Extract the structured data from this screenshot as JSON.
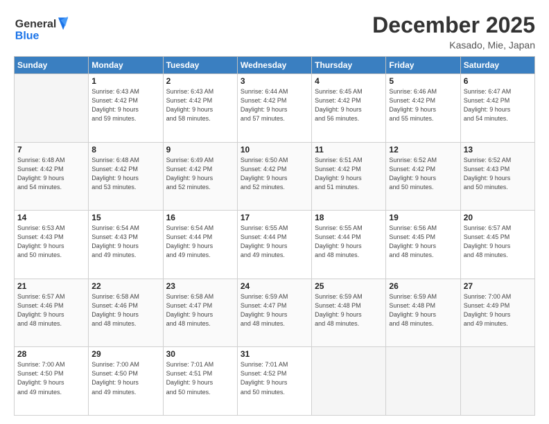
{
  "header": {
    "logo_general": "General",
    "logo_blue": "Blue",
    "month_title": "December 2025",
    "location": "Kasado, Mie, Japan"
  },
  "days_of_week": [
    "Sunday",
    "Monday",
    "Tuesday",
    "Wednesday",
    "Thursday",
    "Friday",
    "Saturday"
  ],
  "weeks": [
    [
      {
        "day": "",
        "empty": true
      },
      {
        "day": "1",
        "sunrise": "Sunrise: 6:43 AM",
        "sunset": "Sunset: 4:42 PM",
        "daylight": "Daylight: 9 hours and 59 minutes."
      },
      {
        "day": "2",
        "sunrise": "Sunrise: 6:43 AM",
        "sunset": "Sunset: 4:42 PM",
        "daylight": "Daylight: 9 hours and 58 minutes."
      },
      {
        "day": "3",
        "sunrise": "Sunrise: 6:44 AM",
        "sunset": "Sunset: 4:42 PM",
        "daylight": "Daylight: 9 hours and 57 minutes."
      },
      {
        "day": "4",
        "sunrise": "Sunrise: 6:45 AM",
        "sunset": "Sunset: 4:42 PM",
        "daylight": "Daylight: 9 hours and 56 minutes."
      },
      {
        "day": "5",
        "sunrise": "Sunrise: 6:46 AM",
        "sunset": "Sunset: 4:42 PM",
        "daylight": "Daylight: 9 hours and 55 minutes."
      },
      {
        "day": "6",
        "sunrise": "Sunrise: 6:47 AM",
        "sunset": "Sunset: 4:42 PM",
        "daylight": "Daylight: 9 hours and 54 minutes."
      }
    ],
    [
      {
        "day": "7",
        "sunrise": "Sunrise: 6:48 AM",
        "sunset": "Sunset: 4:42 PM",
        "daylight": "Daylight: 9 hours and 54 minutes."
      },
      {
        "day": "8",
        "sunrise": "Sunrise: 6:48 AM",
        "sunset": "Sunset: 4:42 PM",
        "daylight": "Daylight: 9 hours and 53 minutes."
      },
      {
        "day": "9",
        "sunrise": "Sunrise: 6:49 AM",
        "sunset": "Sunset: 4:42 PM",
        "daylight": "Daylight: 9 hours and 52 minutes."
      },
      {
        "day": "10",
        "sunrise": "Sunrise: 6:50 AM",
        "sunset": "Sunset: 4:42 PM",
        "daylight": "Daylight: 9 hours and 52 minutes."
      },
      {
        "day": "11",
        "sunrise": "Sunrise: 6:51 AM",
        "sunset": "Sunset: 4:42 PM",
        "daylight": "Daylight: 9 hours and 51 minutes."
      },
      {
        "day": "12",
        "sunrise": "Sunrise: 6:52 AM",
        "sunset": "Sunset: 4:42 PM",
        "daylight": "Daylight: 9 hours and 50 minutes."
      },
      {
        "day": "13",
        "sunrise": "Sunrise: 6:52 AM",
        "sunset": "Sunset: 4:43 PM",
        "daylight": "Daylight: 9 hours and 50 minutes."
      }
    ],
    [
      {
        "day": "14",
        "sunrise": "Sunrise: 6:53 AM",
        "sunset": "Sunset: 4:43 PM",
        "daylight": "Daylight: 9 hours and 50 minutes."
      },
      {
        "day": "15",
        "sunrise": "Sunrise: 6:54 AM",
        "sunset": "Sunset: 4:43 PM",
        "daylight": "Daylight: 9 hours and 49 minutes."
      },
      {
        "day": "16",
        "sunrise": "Sunrise: 6:54 AM",
        "sunset": "Sunset: 4:44 PM",
        "daylight": "Daylight: 9 hours and 49 minutes."
      },
      {
        "day": "17",
        "sunrise": "Sunrise: 6:55 AM",
        "sunset": "Sunset: 4:44 PM",
        "daylight": "Daylight: 9 hours and 49 minutes."
      },
      {
        "day": "18",
        "sunrise": "Sunrise: 6:55 AM",
        "sunset": "Sunset: 4:44 PM",
        "daylight": "Daylight: 9 hours and 48 minutes."
      },
      {
        "day": "19",
        "sunrise": "Sunrise: 6:56 AM",
        "sunset": "Sunset: 4:45 PM",
        "daylight": "Daylight: 9 hours and 48 minutes."
      },
      {
        "day": "20",
        "sunrise": "Sunrise: 6:57 AM",
        "sunset": "Sunset: 4:45 PM",
        "daylight": "Daylight: 9 hours and 48 minutes."
      }
    ],
    [
      {
        "day": "21",
        "sunrise": "Sunrise: 6:57 AM",
        "sunset": "Sunset: 4:46 PM",
        "daylight": "Daylight: 9 hours and 48 minutes."
      },
      {
        "day": "22",
        "sunrise": "Sunrise: 6:58 AM",
        "sunset": "Sunset: 4:46 PM",
        "daylight": "Daylight: 9 hours and 48 minutes."
      },
      {
        "day": "23",
        "sunrise": "Sunrise: 6:58 AM",
        "sunset": "Sunset: 4:47 PM",
        "daylight": "Daylight: 9 hours and 48 minutes."
      },
      {
        "day": "24",
        "sunrise": "Sunrise: 6:59 AM",
        "sunset": "Sunset: 4:47 PM",
        "daylight": "Daylight: 9 hours and 48 minutes."
      },
      {
        "day": "25",
        "sunrise": "Sunrise: 6:59 AM",
        "sunset": "Sunset: 4:48 PM",
        "daylight": "Daylight: 9 hours and 48 minutes."
      },
      {
        "day": "26",
        "sunrise": "Sunrise: 6:59 AM",
        "sunset": "Sunset: 4:48 PM",
        "daylight": "Daylight: 9 hours and 48 minutes."
      },
      {
        "day": "27",
        "sunrise": "Sunrise: 7:00 AM",
        "sunset": "Sunset: 4:49 PM",
        "daylight": "Daylight: 9 hours and 49 minutes."
      }
    ],
    [
      {
        "day": "28",
        "sunrise": "Sunrise: 7:00 AM",
        "sunset": "Sunset: 4:50 PM",
        "daylight": "Daylight: 9 hours and 49 minutes."
      },
      {
        "day": "29",
        "sunrise": "Sunrise: 7:00 AM",
        "sunset": "Sunset: 4:50 PM",
        "daylight": "Daylight: 9 hours and 49 minutes."
      },
      {
        "day": "30",
        "sunrise": "Sunrise: 7:01 AM",
        "sunset": "Sunset: 4:51 PM",
        "daylight": "Daylight: 9 hours and 50 minutes."
      },
      {
        "day": "31",
        "sunrise": "Sunrise: 7:01 AM",
        "sunset": "Sunset: 4:52 PM",
        "daylight": "Daylight: 9 hours and 50 minutes."
      },
      {
        "day": "",
        "empty": true
      },
      {
        "day": "",
        "empty": true
      },
      {
        "day": "",
        "empty": true
      }
    ]
  ]
}
